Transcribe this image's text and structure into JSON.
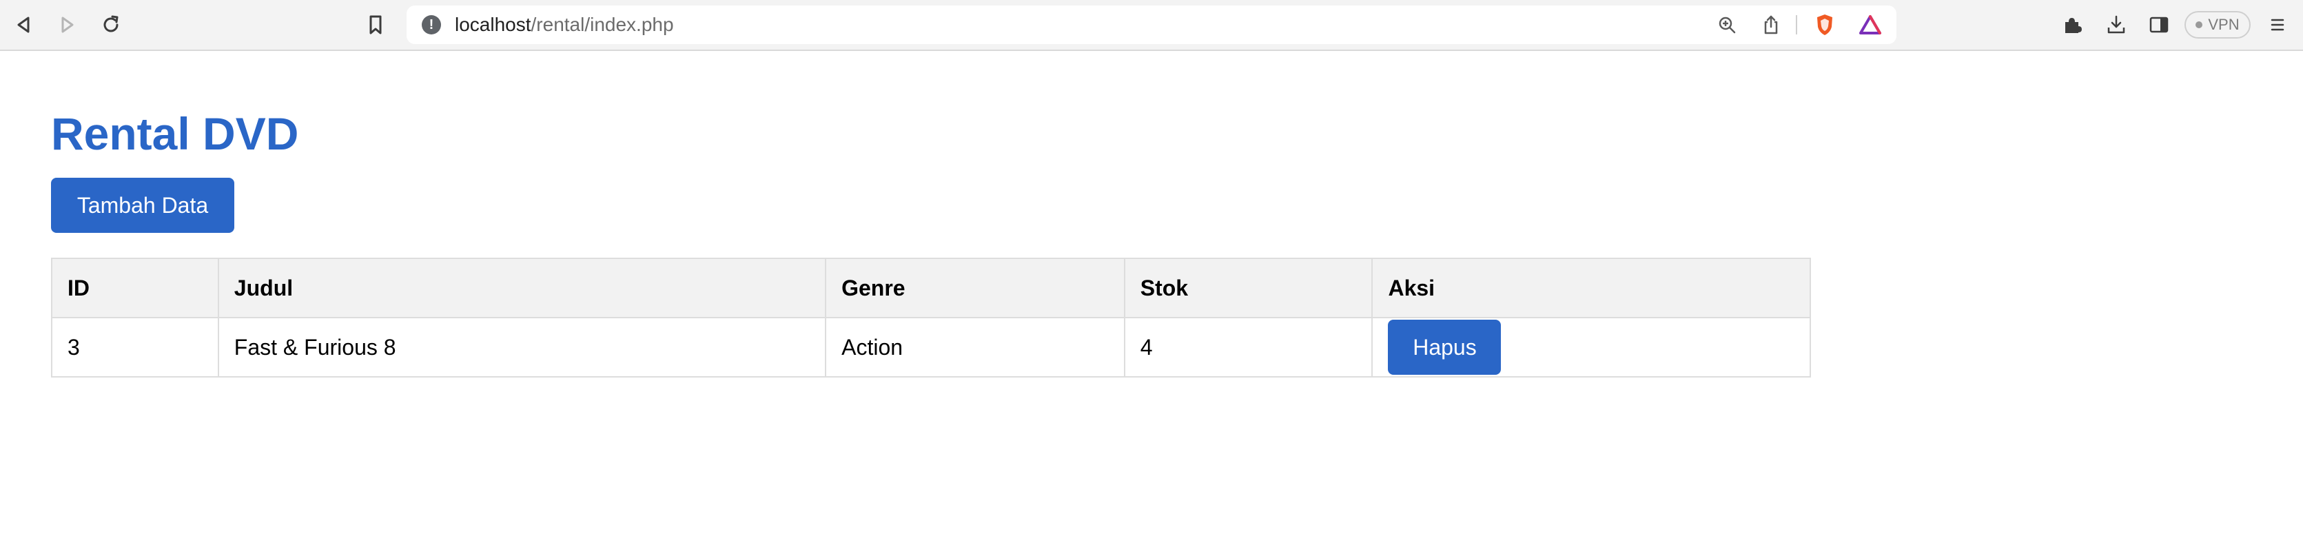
{
  "browser": {
    "url_host": "localhost",
    "url_path": "/rental/index.php",
    "vpn_label": "VPN",
    "nav_icons": [
      "back-icon",
      "forward-icon",
      "reload-icon",
      "bookmark-icon"
    ],
    "url_icons": [
      "site-info-icon",
      "zoom-icon",
      "share-icon",
      "brave-shields-icon",
      "brave-rewards-icon"
    ],
    "right_icons": [
      "extensions-icon",
      "download-icon",
      "sidebar-icon",
      "menu-icon"
    ]
  },
  "page": {
    "title": "Rental DVD",
    "add_button_label": "Tambah Data",
    "table": {
      "headers": [
        "ID",
        "Judul",
        "Genre",
        "Stok",
        "Aksi"
      ],
      "rows": [
        {
          "id": "3",
          "judul": "Fast & Furious 8",
          "genre": "Action",
          "stok": "4",
          "action_label": "Hapus"
        }
      ]
    }
  },
  "colors": {
    "accent": "#2a66c7",
    "header_bg": "#f2f2f2",
    "border": "#dddddd",
    "toolbar_bg": "#f3f3f3"
  }
}
